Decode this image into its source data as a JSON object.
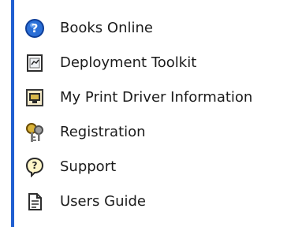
{
  "menu": {
    "accent_color": "#1f5fd1",
    "items": [
      {
        "label": "Books Online",
        "icon": "help-circle-icon"
      },
      {
        "label": "Deployment Toolkit",
        "icon": "certificate-icon"
      },
      {
        "label": "My Print Driver Information",
        "icon": "printer-driver-icon"
      },
      {
        "label": "Registration",
        "icon": "keys-icon"
      },
      {
        "label": "Support",
        "icon": "support-question-icon"
      },
      {
        "label": "Users Guide",
        "icon": "document-icon"
      }
    ]
  }
}
